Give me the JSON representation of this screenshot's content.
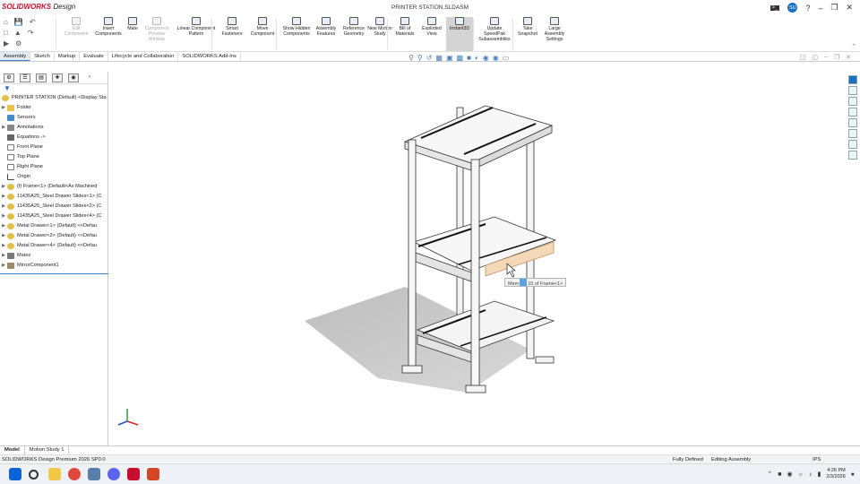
{
  "app": {
    "logo_brand": "SOLIDWORKS",
    "logo_suffix": "Design",
    "document_title": "PRINTER STATION.SLDASM",
    "user_initials": "SU"
  },
  "ribbon": {
    "buttons": [
      {
        "label": "Edit Component",
        "enabled": false
      },
      {
        "label": "Insert Components",
        "enabled": true
      },
      {
        "label": "Mate",
        "enabled": true
      },
      {
        "label": "Component Preview Window",
        "enabled": false
      },
      {
        "label": "Linear Component Pattern",
        "enabled": true
      },
      {
        "label": "Smart Fasteners",
        "enabled": true
      },
      {
        "label": "Move Component",
        "enabled": true
      },
      {
        "label": "Show Hidden Components",
        "enabled": true
      },
      {
        "label": "Assembly Features",
        "enabled": true
      },
      {
        "label": "Reference Geometry",
        "enabled": true
      },
      {
        "label": "New Motion Study",
        "enabled": true
      },
      {
        "label": "Bill of Materials",
        "enabled": true
      },
      {
        "label": "Exploded View",
        "enabled": true
      },
      {
        "label": "Instant3D",
        "enabled": true,
        "active": true
      },
      {
        "label": "Update SpeedPak Subassemblies",
        "enabled": true
      },
      {
        "label": "Take Snapshot",
        "enabled": true
      },
      {
        "label": "Large Assembly Settings",
        "enabled": true
      }
    ]
  },
  "command_tabs": [
    "Assembly",
    "Sketch",
    "Markup",
    "Evaluate",
    "Lifecycle and Collaboration",
    "SOLIDWORKS Add-Ins"
  ],
  "active_command_tab": "Assembly",
  "tree": {
    "root": "PRINTER STATION (Default) <Display Sta",
    "items": [
      {
        "label": "Folder",
        "icon": "folder-icon",
        "expand": true
      },
      {
        "label": "Sensors",
        "icon": "sensor-icon",
        "expand": false
      },
      {
        "label": "Annotations",
        "icon": "annotation-icon",
        "expand": true
      },
      {
        "label": "Equations ->",
        "icon": "equation-icon",
        "expand": false
      },
      {
        "label": "Front Plane",
        "icon": "plane-icon",
        "expand": false
      },
      {
        "label": "Top Plane",
        "icon": "plane-icon",
        "expand": false
      },
      {
        "label": "Right Plane",
        "icon": "plane-icon",
        "expand": false
      },
      {
        "label": "Origin",
        "icon": "origin-icon",
        "expand": false
      },
      {
        "label": "(f) Frame<1> (Default<As Machined",
        "icon": "part-icon",
        "expand": true
      },
      {
        "label": "11435A25_Steel Drawer Slides<1> (C",
        "icon": "part-icon",
        "expand": true
      },
      {
        "label": "11435A25_Steel Drawer Slides<2> (C",
        "icon": "part-icon",
        "expand": true
      },
      {
        "label": "11435A25_Steel Drawer Slides<4> (C",
        "icon": "part-icon",
        "expand": true
      },
      {
        "label": "Metal Drawer<1> (Default) <<Defau",
        "icon": "part-icon",
        "expand": true
      },
      {
        "label": "Metal Drawer<2> (Default) <<Defau",
        "icon": "part-icon",
        "expand": true
      },
      {
        "label": "Metal Drawer<4> (Default) <<Defau",
        "icon": "part-icon",
        "expand": true
      },
      {
        "label": "Mates",
        "icon": "mates-icon",
        "expand": true
      },
      {
        "label": "MirrorComponent1",
        "icon": "mirror-icon",
        "expand": true
      }
    ]
  },
  "viewport": {
    "tooltip_prefix": "Mem",
    "tooltip_suffix": "15 of Frame<1>"
  },
  "bottom_tabs": [
    "Model",
    "Motion Study 1"
  ],
  "status": {
    "left": "SOLIDWORKS Design Premium 2026 SP0.0",
    "defined": "Fully Defined",
    "mode": "Editing Assembly",
    "units": "IPS"
  },
  "taskbar": {
    "time": "4:26 PM",
    "date": "2/3/2026"
  },
  "colors": {
    "brand": "#c8102e",
    "accent": "#3b7ed1",
    "highlight": "#f3d9b8"
  }
}
